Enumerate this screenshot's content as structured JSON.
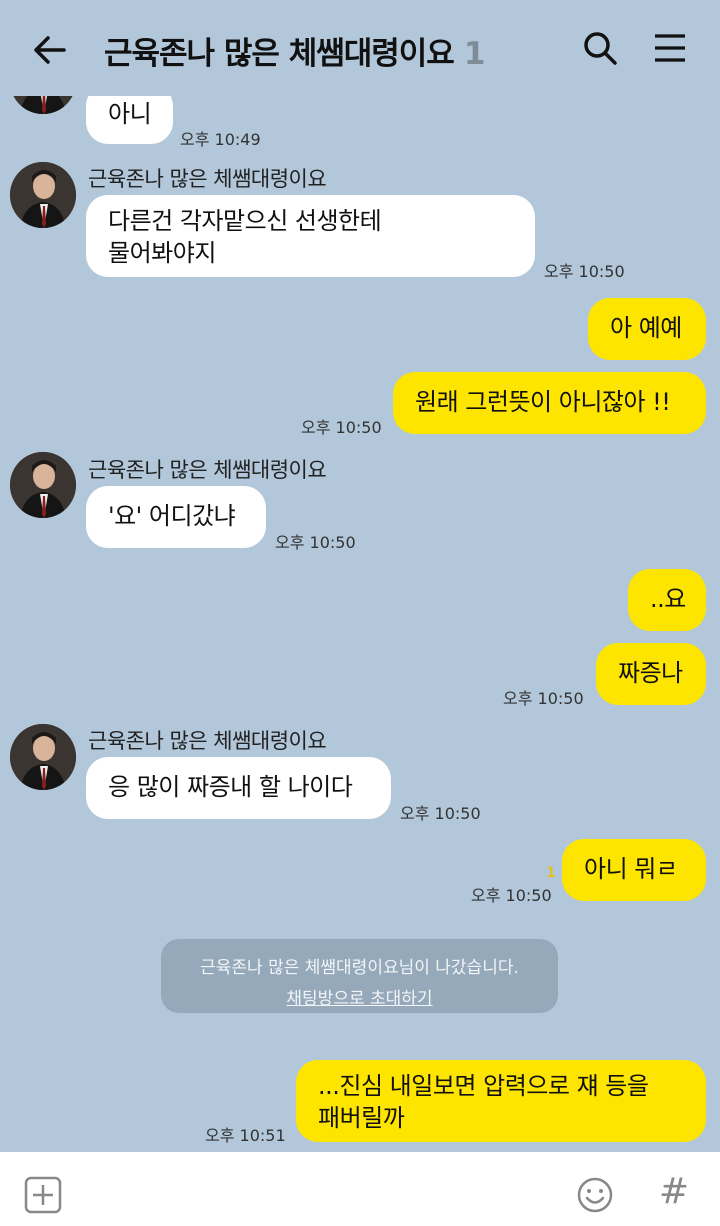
{
  "header": {
    "title": "근육존나 많은 체쌤대령이요",
    "member_count": "1"
  },
  "messages": [
    {
      "text": "아니",
      "time": "오후 10:49"
    },
    {
      "sender": "근육존나 많은 체쌤대령이요",
      "text1": "다른건 각자맡으신 선생한테",
      "text2": "물어봐야지",
      "time": "오후 10:50"
    },
    {
      "text": "아 예예"
    },
    {
      "text": "원래 그런뜻이 아니잖아 !!",
      "time": "오후 10:50"
    },
    {
      "sender": "근육존나 많은 체쌤대령이요",
      "text": "'요' 어디갔냐",
      "time": "오후 10:50"
    },
    {
      "text": "..요"
    },
    {
      "text": "짜증나",
      "time": "오후 10:50"
    },
    {
      "sender": "근육존나 많은 체쌤대령이요",
      "text": "응 많이 짜증내 할 나이다",
      "time": "오후 10:50"
    },
    {
      "text": "아니 뭐ㄹ",
      "time": "오후 10:50",
      "unread": "1"
    },
    {
      "text1": "...진심 내일보면 압력으로 쟤 등을",
      "text2": "패버릴까",
      "time": "오후 10:51"
    }
  ],
  "notice": {
    "text": "근육존나 많은 체쌤대령이요님이 나갔습니다.",
    "invite_link": "채팅방으로 초대하기"
  },
  "icons": {
    "back": "arrow-left-icon",
    "search": "search-icon",
    "menu": "menu-icon",
    "plus": "plus-icon",
    "emoji": "emoji-icon",
    "hash": "#"
  },
  "colors": {
    "background": "#b2c7da",
    "outgoing_bubble": "#fee500",
    "incoming_bubble": "#ffffff"
  }
}
